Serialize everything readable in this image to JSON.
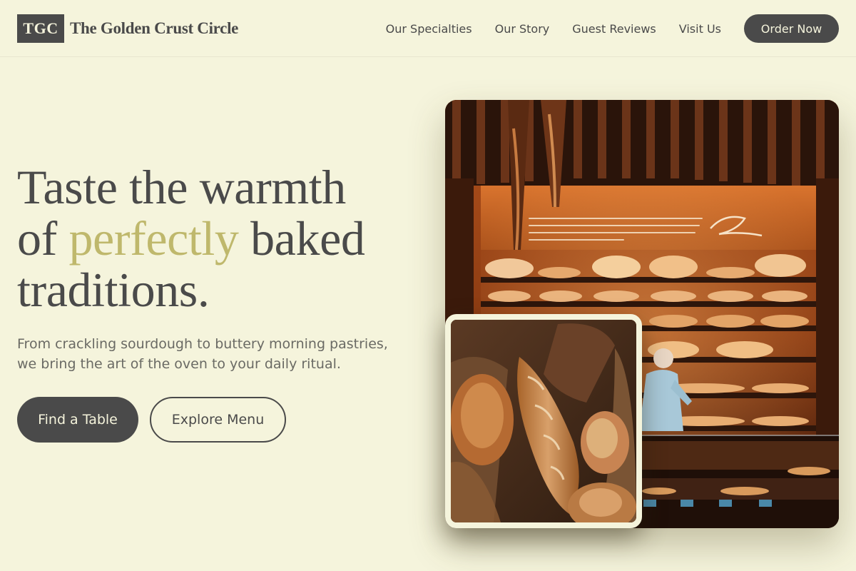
{
  "brand": {
    "mark": "TGC",
    "name": "The Golden Crust Circle"
  },
  "nav": {
    "items": [
      {
        "label": "Our Specialties"
      },
      {
        "label": "Our Story"
      },
      {
        "label": "Guest Reviews"
      },
      {
        "label": "Visit Us"
      }
    ],
    "cta_label": "Order Now"
  },
  "hero": {
    "headline": {
      "line1": "Taste the warmth",
      "line2_prefix": "of ",
      "line2_accent": "perfectly",
      "line2_suffix": " baked",
      "line3": "traditions."
    },
    "subtitle": "From crackling sourdough to buttery morning pastries, we bring the art of the oven to your daily ritual.",
    "primary_cta": "Find a Table",
    "secondary_cta": "Explore Menu"
  },
  "colors": {
    "background": "#f5f4dc",
    "ink": "#4a4a4a",
    "accent": "#bfb86c",
    "muted_text": "#6a6a64"
  },
  "images": {
    "main": "bakery-counter-photo",
    "inset": "artisan-bread-basket-photo"
  }
}
